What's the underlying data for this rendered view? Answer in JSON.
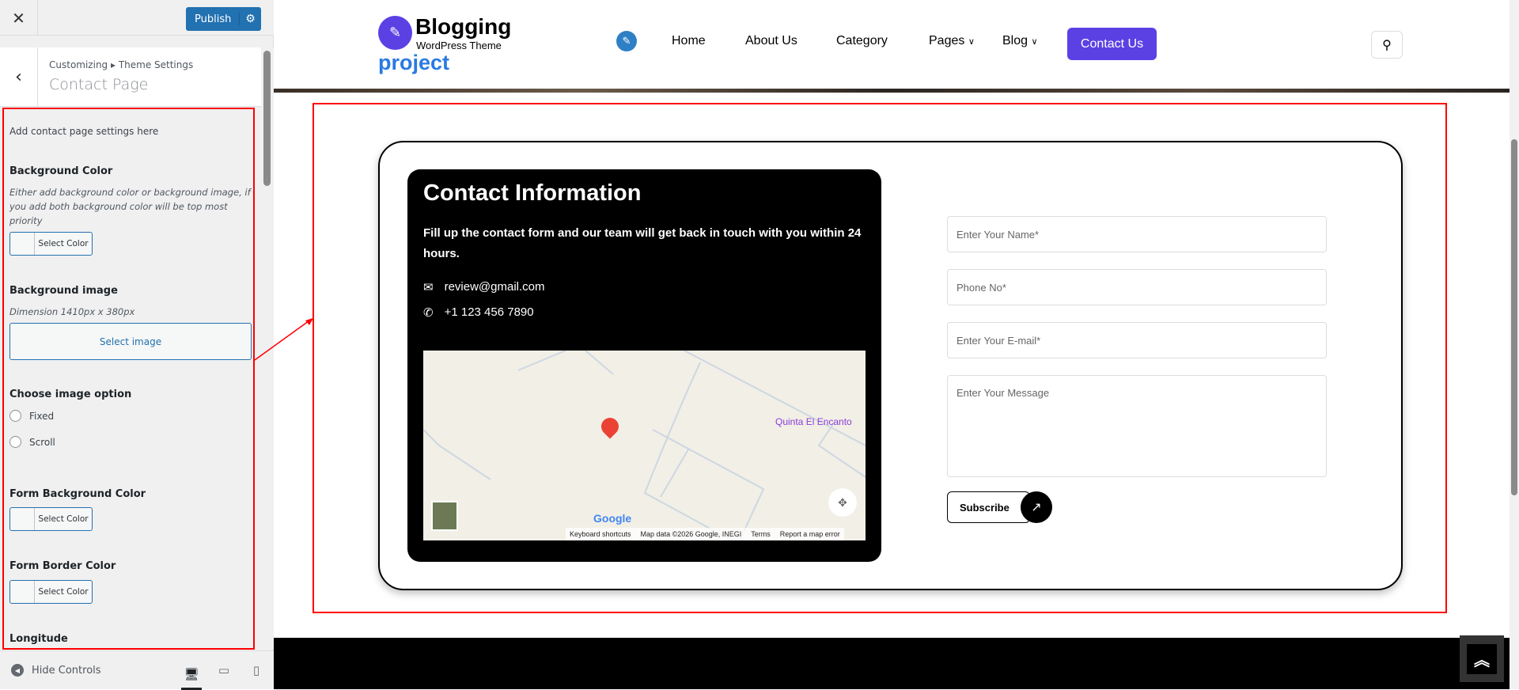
{
  "customizer": {
    "close_icon": "close-icon",
    "publish_label": "Publish",
    "breadcrumb": "Customizing ▸ Theme Settings",
    "section_title": "Contact Page",
    "description": "Add contact page settings here",
    "background_color": {
      "label": "Background Color",
      "note": "Either add background color or background image, if you add both background color will be top most priority",
      "button": "Select Color"
    },
    "background_image": {
      "label": "Background image",
      "note": "Dimension 1410px x 380px",
      "button": "Select image"
    },
    "image_option": {
      "label": "Choose image option",
      "options": [
        "Fixed",
        "Scroll"
      ]
    },
    "form_background_color": {
      "label": "Form Background Color",
      "button": "Select Color"
    },
    "form_border_color": {
      "label": "Form Border Color",
      "button": "Select Color"
    },
    "longitude": {
      "label": "Longitude"
    },
    "hide_controls": "Hide Controls"
  },
  "site": {
    "logo_title": "Blogging",
    "logo_subtitle": "WordPress Theme",
    "site_name": "project",
    "nav": [
      "Home",
      "About Us",
      "Category",
      "Pages",
      "Blog"
    ],
    "cta": "Contact Us",
    "colors": {
      "accent": "#5b40e4",
      "link": "#2a7ae2"
    }
  },
  "contact": {
    "title": "Contact Information",
    "text": "Fill up the contact form and our team will get back in touch with you within 24 hours.",
    "email": "review@gmail.com",
    "phone": "+1 123 456 7890",
    "map": {
      "place": "Quinta El Encanto",
      "logo": "Google",
      "footer": [
        "Keyboard shortcuts",
        "Map data ©2026 Google, INEGI",
        "Terms",
        "Report a map error"
      ]
    },
    "form": {
      "name_placeholder": "Enter Your Name*",
      "phone_placeholder": "Phone No*",
      "email_placeholder": "Enter Your E-mail*",
      "message_placeholder": "Enter Your Message",
      "submit": "Subscribe"
    }
  }
}
